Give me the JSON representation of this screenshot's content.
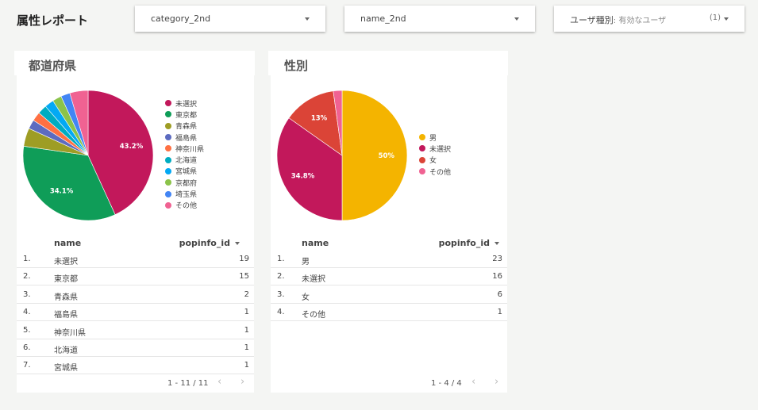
{
  "header": {
    "title": "属性レポート"
  },
  "filters": {
    "category": {
      "label": "category_2nd"
    },
    "name": {
      "label": "name_2nd"
    },
    "user_type": {
      "label": "ユーザ種別",
      "value": ": 有効なユーザ",
      "count": "(1)"
    }
  },
  "prefecture": {
    "title": "都道府県",
    "legend": [
      "未選択",
      "東京都",
      "青森県",
      "福島県",
      "神奈川県",
      "北海道",
      "宮城県",
      "京都府",
      "埼玉県",
      "その他"
    ],
    "table": {
      "col_name": "name",
      "col_value": "popinfo_id",
      "rows": [
        {
          "idx": "1.",
          "name": "未選択",
          "value": "19"
        },
        {
          "idx": "2.",
          "name": "東京都",
          "value": "15"
        },
        {
          "idx": "3.",
          "name": "青森県",
          "value": "2"
        },
        {
          "idx": "4.",
          "name": "福島県",
          "value": "1"
        },
        {
          "idx": "5.",
          "name": "神奈川県",
          "value": "1"
        },
        {
          "idx": "6.",
          "name": "北海道",
          "value": "1"
        },
        {
          "idx": "7.",
          "name": "宮城県",
          "value": "1"
        }
      ]
    },
    "pager": "1 - 11 / 11"
  },
  "gender": {
    "title": "性別",
    "legend": [
      "男",
      "未選択",
      "女",
      "その他"
    ],
    "table": {
      "col_name": "name",
      "col_value": "popinfo_id",
      "rows": [
        {
          "idx": "1.",
          "name": "男",
          "value": "23"
        },
        {
          "idx": "2.",
          "name": "未選択",
          "value": "16"
        },
        {
          "idx": "3.",
          "name": "女",
          "value": "6"
        },
        {
          "idx": "4.",
          "name": "その他",
          "value": "1"
        }
      ]
    },
    "pager": "1 - 4 / 4"
  },
  "pager_icons": {
    "prev": "chevron-left-icon",
    "next": "chevron-right-icon",
    "prev_glyph": "‹",
    "next_glyph": "›"
  },
  "chart_data": [
    {
      "type": "pie",
      "title": "都道府県",
      "categories": [
        "未選択",
        "東京都",
        "青森県",
        "福島県",
        "神奈川県",
        "北海道",
        "宮城県",
        "京都府",
        "埼玉県",
        "その他"
      ],
      "values": [
        19,
        15,
        2,
        1,
        1,
        1,
        1,
        1,
        1,
        2
      ],
      "colors": [
        "#c2185b",
        "#0f9d58",
        "#9e9d24",
        "#5c6bc0",
        "#ff7043",
        "#00acc1",
        "#03a9f4",
        "#8bc34a",
        "#4285f4",
        "#f06292"
      ],
      "data_labels": [
        "43.2%",
        "34.1%",
        "",
        "",
        "",
        "",
        "",
        "",
        "",
        ""
      ],
      "legend_position": "right"
    },
    {
      "type": "pie",
      "title": "性別",
      "categories": [
        "男",
        "未選択",
        "女",
        "その他"
      ],
      "values": [
        23,
        16,
        6,
        1
      ],
      "colors": [
        "#f4b400",
        "#c2185b",
        "#db4437",
        "#f06292"
      ],
      "data_labels": [
        "50%",
        "34.8%",
        "13%",
        ""
      ],
      "legend_position": "right"
    }
  ]
}
